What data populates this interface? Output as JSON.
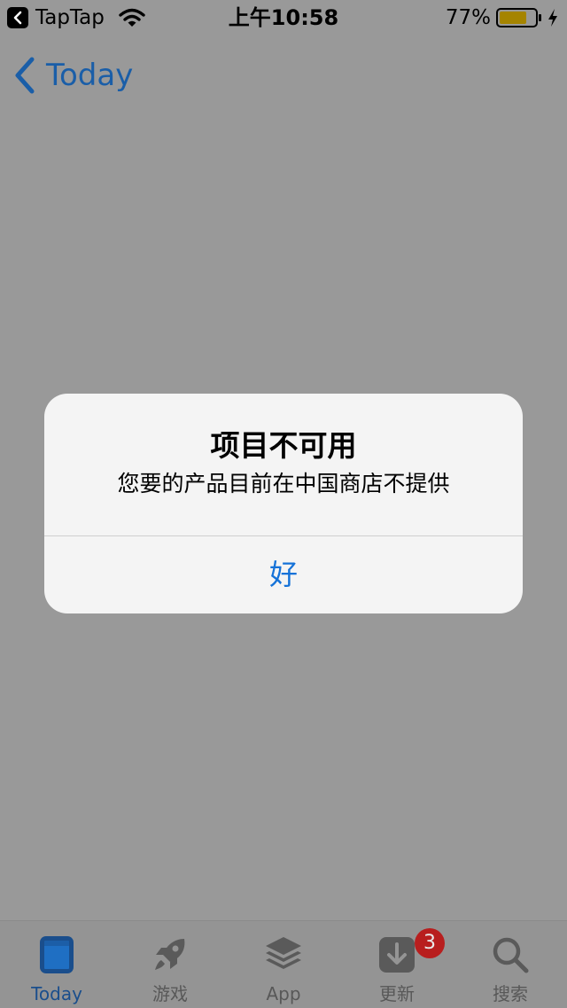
{
  "status_bar": {
    "back_app": "TapTap",
    "time": "上午10:58",
    "battery": "77%",
    "battery_level": 0.77
  },
  "nav": {
    "back_label": "Today"
  },
  "alert": {
    "title": "项目不可用",
    "message": "您要的产品目前在中国商店不提供",
    "button": "好"
  },
  "tabs": [
    {
      "label": "Today",
      "icon": "today-icon",
      "active": true
    },
    {
      "label": "游戏",
      "icon": "rocket-icon",
      "active": false
    },
    {
      "label": "App",
      "icon": "layers-icon",
      "active": false
    },
    {
      "label": "更新",
      "icon": "download-icon",
      "active": false,
      "badge": "3"
    },
    {
      "label": "搜索",
      "icon": "search-icon",
      "active": false
    }
  ],
  "colors": {
    "accent": "#1572d8",
    "dim_background": "#999999",
    "badge": "#b81e1e"
  }
}
